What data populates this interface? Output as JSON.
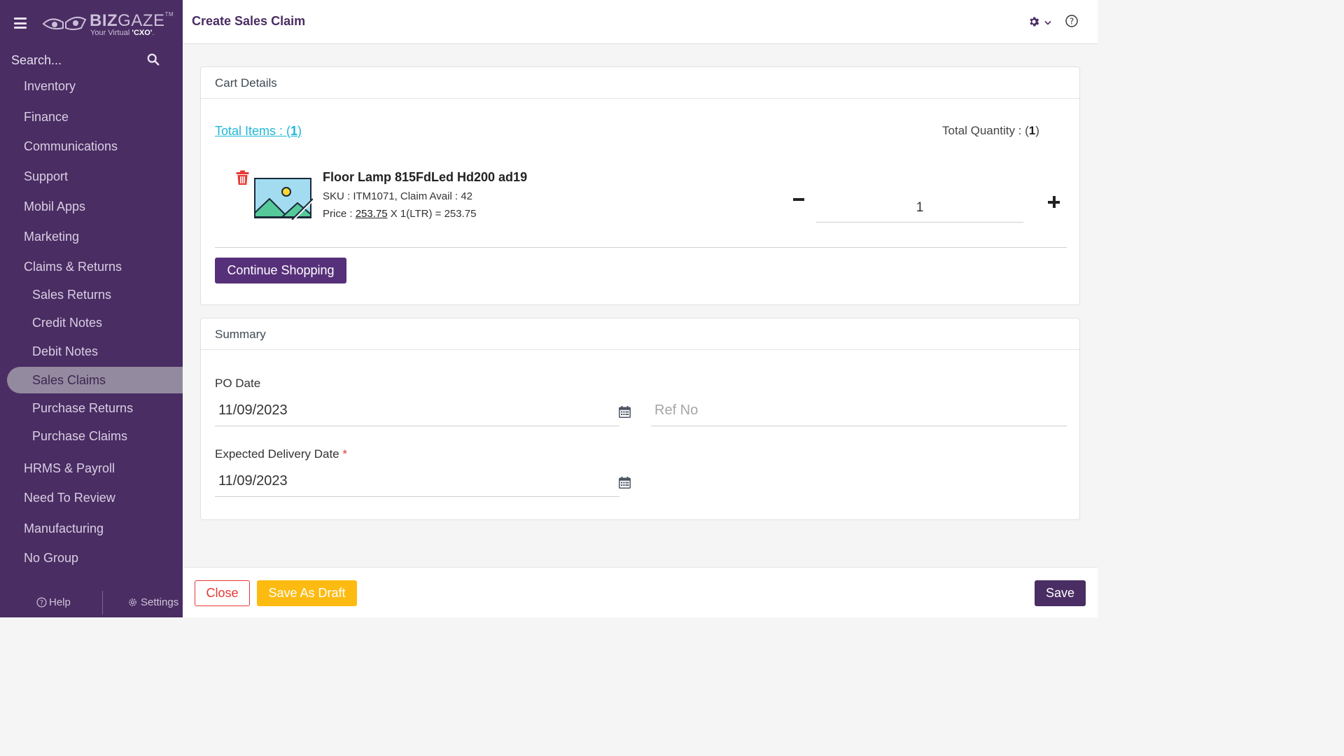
{
  "brand": {
    "name_bold": "BIZ",
    "name_light": "GAZE",
    "trademark": "TM",
    "tagline_prefix": "Your Virtual ",
    "tagline_bold": "'CXO'",
    "tagline_suffix": "."
  },
  "sidebar": {
    "search_placeholder": "Search...",
    "items": [
      {
        "label": "Inventory",
        "level": "top",
        "active": false
      },
      {
        "label": "Finance",
        "level": "top",
        "active": false
      },
      {
        "label": "Communications",
        "level": "top",
        "active": false
      },
      {
        "label": "Support",
        "level": "top",
        "active": false
      },
      {
        "label": "Mobil Apps",
        "level": "top",
        "active": false
      },
      {
        "label": "Marketing",
        "level": "top",
        "active": false
      },
      {
        "label": "Claims & Returns",
        "level": "top",
        "active": false
      },
      {
        "label": "Sales Returns",
        "level": "sub",
        "active": false
      },
      {
        "label": "Credit Notes",
        "level": "sub",
        "active": false
      },
      {
        "label": "Debit Notes",
        "level": "sub",
        "active": false
      },
      {
        "label": "Sales Claims",
        "level": "sub",
        "active": true
      },
      {
        "label": "Purchase Returns",
        "level": "sub",
        "active": false
      },
      {
        "label": "Purchase Claims",
        "level": "sub",
        "active": false
      },
      {
        "label": "HRMS & Payroll",
        "level": "top",
        "active": false
      },
      {
        "label": "Need To Review",
        "level": "top",
        "active": false
      },
      {
        "label": "Manufacturing",
        "level": "top",
        "active": false
      },
      {
        "label": "No Group",
        "level": "top",
        "active": false
      }
    ],
    "footer": {
      "help_label": "Help",
      "settings_label": "Settings"
    }
  },
  "header": {
    "title": "Create Sales Claim"
  },
  "cart": {
    "section_title": "Cart Details",
    "total_items_label": "Total Items : (",
    "total_items_value": "1",
    "total_items_close": ")",
    "total_qty_label": "Total Quantity : (",
    "total_qty_value": "1",
    "total_qty_close": ")",
    "item": {
      "name": "Floor Lamp 815FdLed Hd200 ad19",
      "sku_line": "SKU : ITM1071, Claim Avail : 42",
      "price_label": "Price : ",
      "price_value": "253.75",
      "price_formula": " X 1(LTR) = 253.75",
      "quantity": "1"
    },
    "continue_label": "Continue Shopping"
  },
  "summary": {
    "section_title": "Summary",
    "po_date_label": "PO Date",
    "po_date_value": "11/09/2023",
    "ref_no_placeholder": "Ref No",
    "delivery_label": "Expected Delivery Date",
    "required_mark": "*",
    "delivery_value": "11/09/2023"
  },
  "actions": {
    "close_label": "Close",
    "draft_label": "Save As Draft",
    "save_label": "Save"
  },
  "colors": {
    "sidebar_bg": "#4a2d63",
    "accent": "#57307a",
    "link": "#1fb8d8",
    "danger": "#e53935",
    "warning": "#fdbb11"
  },
  "icons": [
    "menu-icon",
    "bizgaze-eyes-logo",
    "search-icon",
    "help-circle-icon",
    "gear-icon",
    "chevron-down-icon",
    "trash-icon",
    "image-placeholder-icon",
    "minus-icon",
    "plus-icon",
    "calendar-icon"
  ]
}
